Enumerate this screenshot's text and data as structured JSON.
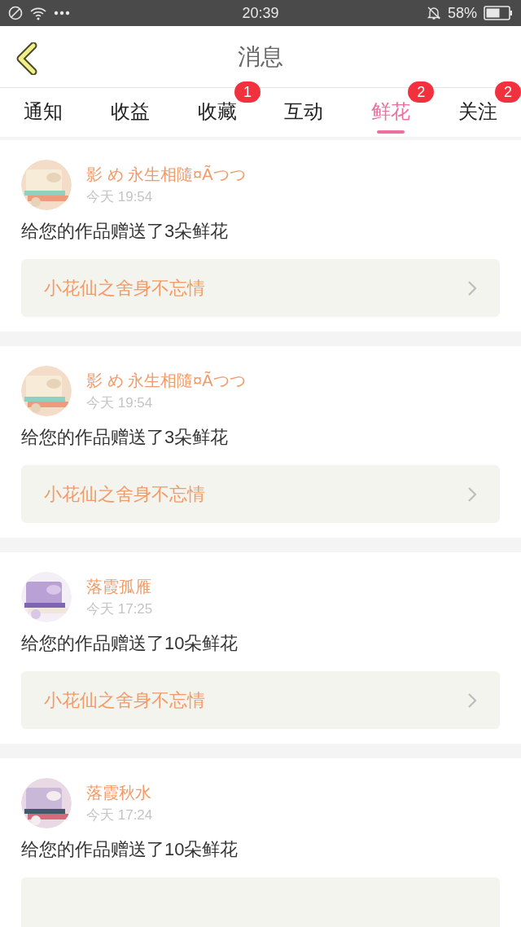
{
  "status_bar": {
    "time": "20:39",
    "battery": "58%"
  },
  "header": {
    "title": "消息"
  },
  "tabs": [
    {
      "label": "通知",
      "selected": false
    },
    {
      "label": "收益",
      "selected": false
    },
    {
      "label": "收藏",
      "selected": false,
      "badge": "1"
    },
    {
      "label": "互动",
      "selected": false
    },
    {
      "label": "鲜花",
      "selected": true,
      "badge": "2"
    },
    {
      "label": "关注",
      "selected": false,
      "badge": "2"
    }
  ],
  "messages": [
    {
      "name": "影 め 永生相隨¤Ãつつ",
      "time": "今天 19:54",
      "text": "给您的作品赠送了3朵鲜花",
      "work": "小花仙之舍身不忘情"
    },
    {
      "name": "影 め 永生相隨¤Ãつつ",
      "time": "今天 19:54",
      "text": "给您的作品赠送了3朵鲜花",
      "work": "小花仙之舍身不忘情"
    },
    {
      "name": "落霞孤雁",
      "time": "今天 17:25",
      "text": "给您的作品赠送了10朵鲜花",
      "work": "小花仙之舍身不忘情"
    },
    {
      "name": "落霞秋水",
      "time": "今天 17:24",
      "text": "给您的作品赠送了10朵鲜花"
    }
  ]
}
